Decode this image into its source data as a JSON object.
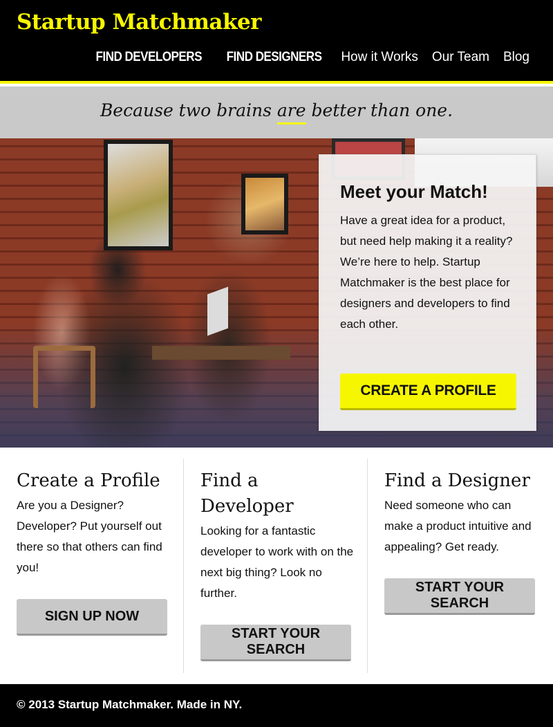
{
  "header": {
    "brand": "Startup Matchmaker",
    "nav": [
      {
        "label": "FIND DEVELOPERS"
      },
      {
        "label": "FIND DESIGNERS"
      },
      {
        "label": "How it Works"
      },
      {
        "label": "Our Team"
      },
      {
        "label": "Blog"
      }
    ]
  },
  "tagline": {
    "before": "Because two brains ",
    "emphasis": "are",
    "after": " better than one."
  },
  "hero": {
    "card_title": "Meet your Match!",
    "card_text": "Have a great idea for a product, but need help making it a reality? We’re here to help. Startup Matchmaker is the best place for designers and developers to find each other.",
    "cta": "CREATE A PROFILE"
  },
  "columns": [
    {
      "title": "Create a Profile",
      "text": "Are you a Designer? Developer? Put yourself out there so that others can find you!",
      "button": "SIGN UP NOW"
    },
    {
      "title": "Find a Developer",
      "text": "Looking for a fantastic developer to work with on the next big thing? Look no further.",
      "button": "START YOUR SEARCH"
    },
    {
      "title": "Find a Designer",
      "text": "Need someone who can make a product intuitive and appealing? Get ready.",
      "button": "START YOUR SEARCH"
    }
  ],
  "footer": {
    "text": "© 2013 Startup Matchmaker. Made in NY."
  },
  "colors": {
    "accent": "#f6f600",
    "header_bg": "#000000",
    "tagline_bg": "#c9c9c9",
    "button_gray": "#c8c8c8"
  }
}
